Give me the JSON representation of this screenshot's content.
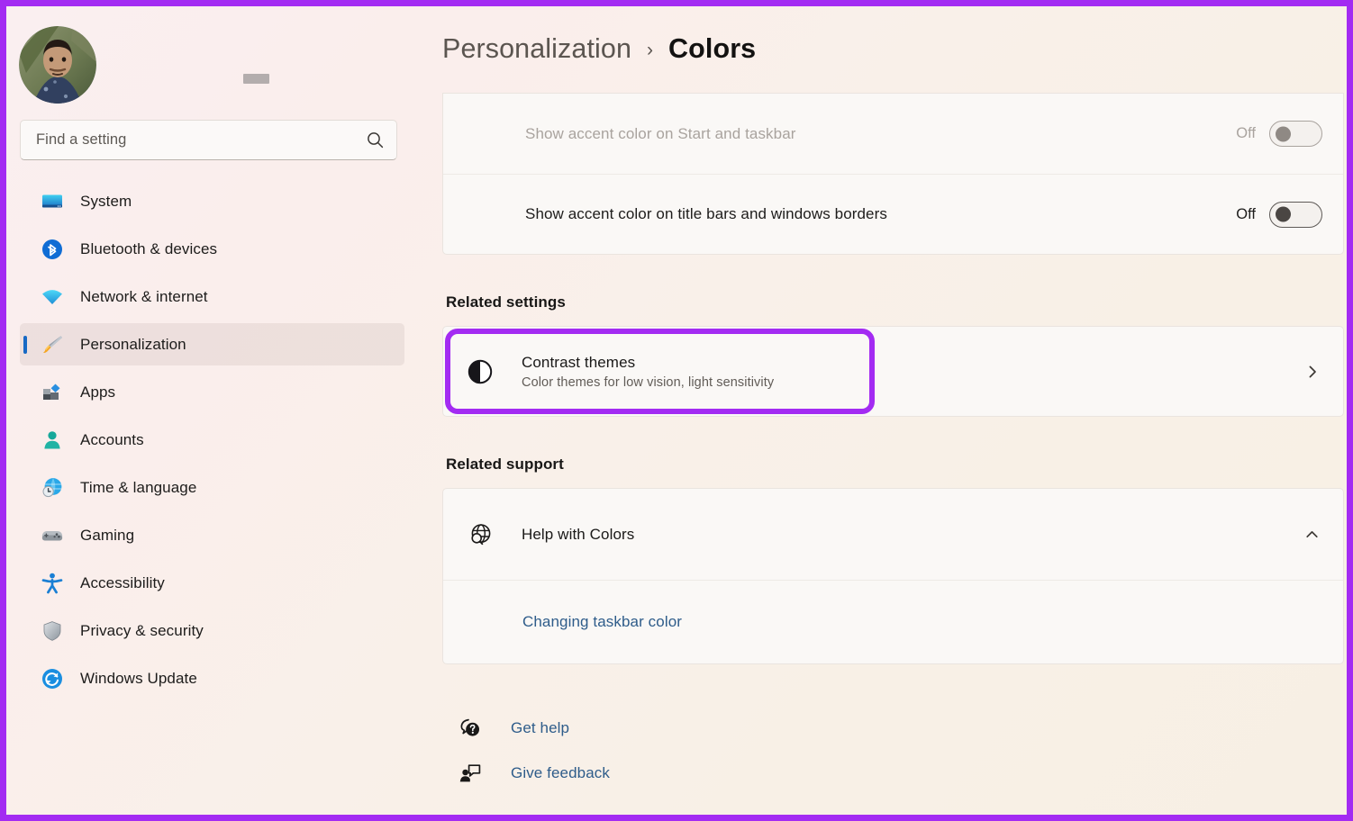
{
  "window": {
    "app_title": "Settings",
    "annotation_color": "#a32bf2"
  },
  "sidebar": {
    "account": {
      "avatar_alt": "user-profile-photo",
      "name_redacted": true
    },
    "search": {
      "placeholder": "Find a setting",
      "value": "",
      "icon": "search-icon"
    },
    "items": [
      {
        "label": "System",
        "icon": "monitor-icon",
        "selected": false
      },
      {
        "label": "Bluetooth & devices",
        "icon": "bluetooth-icon",
        "selected": false
      },
      {
        "label": "Network & internet",
        "icon": "wifi-icon",
        "selected": false
      },
      {
        "label": "Personalization",
        "icon": "paintbrush-icon",
        "selected": true
      },
      {
        "label": "Apps",
        "icon": "apps-icon",
        "selected": false
      },
      {
        "label": "Accounts",
        "icon": "person-icon",
        "selected": false
      },
      {
        "label": "Time & language",
        "icon": "clock-globe-icon",
        "selected": false
      },
      {
        "label": "Gaming",
        "icon": "gamepad-icon",
        "selected": false
      },
      {
        "label": "Accessibility",
        "icon": "accessibility-icon",
        "selected": false
      },
      {
        "label": "Privacy & security",
        "icon": "shield-icon",
        "selected": false
      },
      {
        "label": "Windows Update",
        "icon": "update-icon",
        "selected": false
      }
    ]
  },
  "header": {
    "breadcrumb_parent": "Personalization",
    "breadcrumb_separator": "›",
    "breadcrumb_current": "Colors"
  },
  "main": {
    "accent_settings": [
      {
        "label": "Show accent color on Start and taskbar",
        "state": "Off",
        "enabled": false
      },
      {
        "label": "Show accent color on title bars and windows borders",
        "state": "Off",
        "enabled": true
      }
    ],
    "related_settings": {
      "heading": "Related settings",
      "contrast_themes": {
        "title": "Contrast themes",
        "subtitle": "Color themes for low vision, light sensitivity",
        "icon": "contrast-circle-icon",
        "chevron": "chevron-right-icon",
        "highlighted": true
      }
    },
    "related_support": {
      "heading": "Related support",
      "help_row": {
        "title": "Help with Colors",
        "icon": "globe-help-icon",
        "chevron": "chevron-up-icon",
        "expanded": true
      },
      "links": [
        {
          "label": "Changing taskbar color"
        }
      ]
    },
    "footer_links": [
      {
        "label": "Get help",
        "icon": "get-help-icon"
      },
      {
        "label": "Give feedback",
        "icon": "give-feedback-icon"
      }
    ]
  }
}
